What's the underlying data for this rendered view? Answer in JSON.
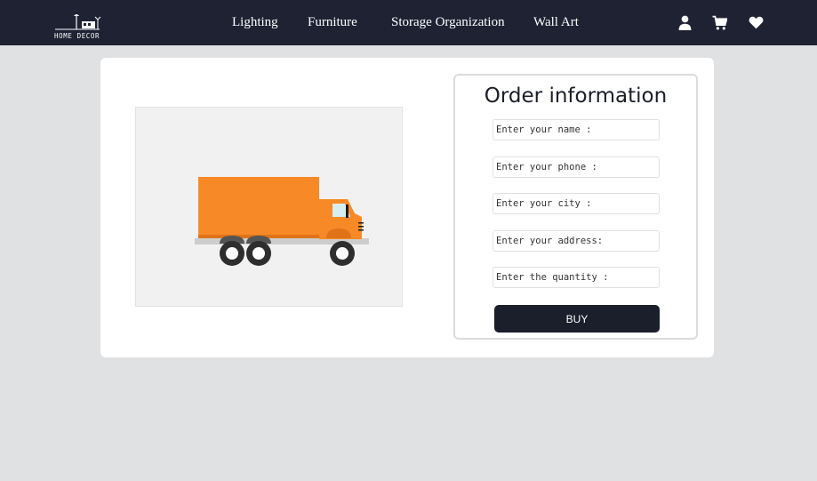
{
  "brand": {
    "logo_text": "HOME DECOR"
  },
  "nav": {
    "links": [
      {
        "label": "Lighting"
      },
      {
        "label": "Furniture"
      },
      {
        "label": "Storage Organization"
      },
      {
        "label": "Wall Art"
      }
    ],
    "icons": [
      "user-icon",
      "cart-icon",
      "heart-icon"
    ]
  },
  "product": {
    "image_icon": "delivery-truck"
  },
  "order": {
    "title": "Order information",
    "fields": [
      {
        "placeholder": "Enter your name :",
        "value": ""
      },
      {
        "placeholder": "Enter your phone :",
        "value": ""
      },
      {
        "placeholder": "Enter your city :",
        "value": ""
      },
      {
        "placeholder": "Enter your address:",
        "value": ""
      },
      {
        "placeholder": "Enter the quantity :",
        "value": ""
      }
    ],
    "buy_label": "BUY"
  },
  "colors": {
    "navbar": "#1e2233",
    "page_background": "#e0e1e3",
    "truck_body": "#f78a27",
    "button": "#1b1e2b"
  }
}
